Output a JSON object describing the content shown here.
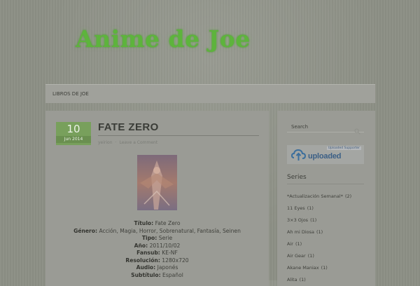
{
  "site": {
    "title": "Anime de Joe"
  },
  "nav": {
    "items": [
      {
        "label": "LIBROS DE JOE"
      }
    ]
  },
  "post": {
    "date_day": "10",
    "date_month": "Jun 2014",
    "title": "FATE ZERO",
    "author": "yeirion",
    "comment_link": "Leave a Comment",
    "fields": [
      {
        "key": "Título:",
        "value": "Fate Zero"
      },
      {
        "key": "Género:",
        "value": "Acción, Magia, Horror, Sobrenatural, Fantasía, Seinen"
      },
      {
        "key": "Tipo:",
        "value": "Serie"
      },
      {
        "key": "Año:",
        "value": "2011/10/02"
      },
      {
        "key": "Fansub:",
        "value": "KE-NF"
      },
      {
        "key": "Resolución:",
        "value": "1280x720"
      },
      {
        "key": "Audio:",
        "value": "Japonés"
      },
      {
        "key": "Subtítulo:",
        "value": "Español"
      }
    ]
  },
  "sidebar": {
    "search_placeholder": "Search",
    "banner": {
      "tag": "Uploaded Supporter",
      "word": "uploaded"
    },
    "series_title": "Series",
    "series": [
      {
        "label": "*Actualización Semanal*",
        "count": "(2)"
      },
      {
        "label": "11 Eyes",
        "count": "(1)"
      },
      {
        "label": "3×3 Ojos",
        "count": "(1)"
      },
      {
        "label": "Ah mi Diosa",
        "count": "(1)"
      },
      {
        "label": "Air",
        "count": "(1)"
      },
      {
        "label": "Air Gear",
        "count": "(1)"
      },
      {
        "label": "Akane Maniax",
        "count": "(1)"
      },
      {
        "label": "Alita",
        "count": "(1)"
      }
    ]
  },
  "colors": {
    "title_green": "#5db43c",
    "date_box": "#78a05c",
    "background": "#8c8f85",
    "panel": "#9a9b95"
  },
  "icons": {
    "search": "search-icon",
    "uploaded_logo": "cloud-upload-icon"
  }
}
